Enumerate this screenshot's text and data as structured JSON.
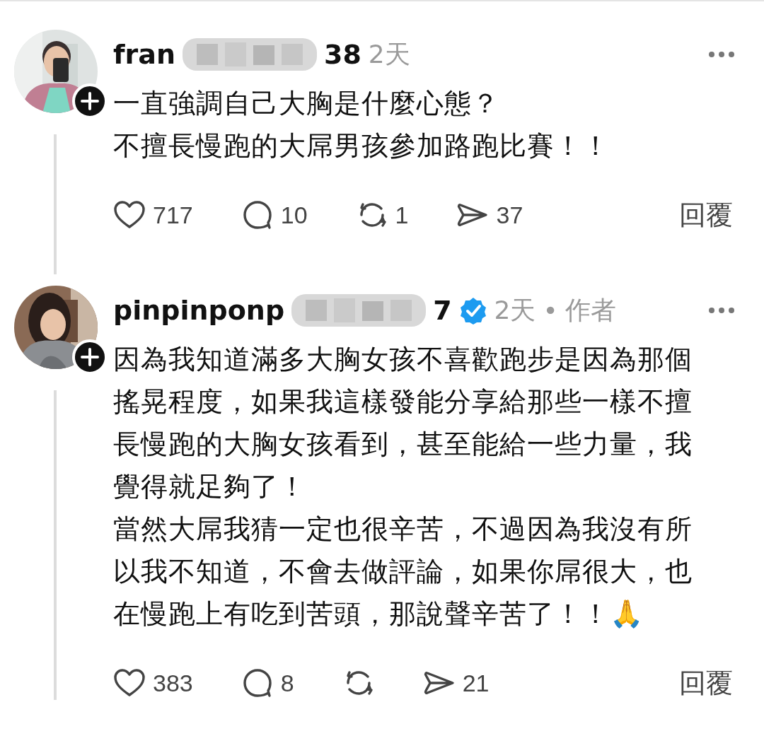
{
  "comments": [
    {
      "username_start": "fran",
      "username_end": "38",
      "time": "2天",
      "body": [
        "一直強調自己大胸是什麼心態？",
        "不擅長慢跑的大屌男孩參加路跑比賽！！"
      ],
      "actions": [
        {
          "kind": "like",
          "count": "717"
        },
        {
          "kind": "comment",
          "count": "10"
        },
        {
          "kind": "repost",
          "count": "1"
        },
        {
          "kind": "share",
          "count": "37"
        }
      ],
      "reply": "回覆"
    },
    {
      "username_start": "pinpinponp",
      "username_end": "7",
      "verified": true,
      "time": "2天",
      "separator": "•",
      "author_label": "作者",
      "body": [
        "因為我知道滿多大胸女孩不喜歡跑步是因為那個搖晃程度，如果我這樣發能分享給那些一樣不擅長慢跑的大胸女孩看到，甚至能給一些力量，我覺得就足夠了！",
        "當然大屌我猜一定也很辛苦，不過因為我沒有所以我不知道，不會去做評論，如果你屌很大，也在慢跑上有吃到苦頭，那說聲辛苦了！！🙏"
      ],
      "actions": [
        {
          "kind": "like",
          "count": "383"
        },
        {
          "kind": "comment",
          "count": "8"
        },
        {
          "kind": "repost"
        },
        {
          "kind": "share",
          "count": "21"
        }
      ],
      "reply": "回覆"
    }
  ]
}
